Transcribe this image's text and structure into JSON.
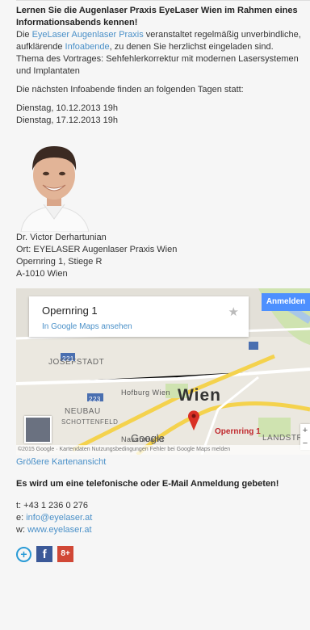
{
  "intro": {
    "heading": "Lernen Sie die Augenlaser Praxis EyeLaser Wien im Rahmen eines Informationsabends kennen!",
    "p1_a": "Die ",
    "p1_link1": "EyeLaser Augenlaser Praxis",
    "p1_b": " veranstaltet regelmäßig unverbindliche, aufklärende ",
    "p1_link2": "Infoabende",
    "p1_c": ", zu denen Sie herzlichst eingeladen sind.",
    "topic": "Thema des Vortrages: Sehfehlerkorrektur mit modernen Lasersystemen und Implantaten",
    "dates_intro": "Die nächsten Infoabende finden an folgenden Tagen statt:",
    "dates": [
      "Dienstag, 10.12.2013 19h",
      "Dienstag, 17.12.2013 19h"
    ]
  },
  "contact_person": {
    "name": "Dr. Victor Derhartunian",
    "location": "Ort: EYELASER Augenlaser Praxis Wien",
    "street": "Opernring 1, Stiege R",
    "city": "A-1010 Wien"
  },
  "map": {
    "card_title": "Opernring 1",
    "card_link": "In Google Maps ansehen",
    "signin": "Anmelden",
    "labels": {
      "josefstadt": "JOSEFSTADT",
      "neubau": "NEUBAU",
      "schottenfeld": "SCHOTTENFELD",
      "hofburg": "Hofburg Wien",
      "naschmarkt": "Naschmarkt",
      "landstr": "LANDSTR",
      "wien": "Wien",
      "pin": "Opernring 1",
      "google": "Google",
      "r221": "221",
      "r223": "223"
    },
    "footer": "©2015 Google · Kartendaten   Nutzungsbedingungen   Fehler bei Google Maps melden",
    "larger_link": "Größere Kartenansicht"
  },
  "register": {
    "heading": "Es wird um eine telefonische oder E-Mail Anmeldung gebeten!",
    "phone": "t: +43 1 236 0 276",
    "email_prefix": "e: ",
    "email": "info@eyelaser.at",
    "web_prefix": "w: ",
    "web": "www.eyelaser.at"
  },
  "social": {
    "addthis": "+",
    "facebook": "f",
    "gplus": "8+"
  },
  "colors": {
    "link": "#4a90c8",
    "facebook": "#3b5998",
    "gplus": "#d14836",
    "pin": "#d93025"
  }
}
